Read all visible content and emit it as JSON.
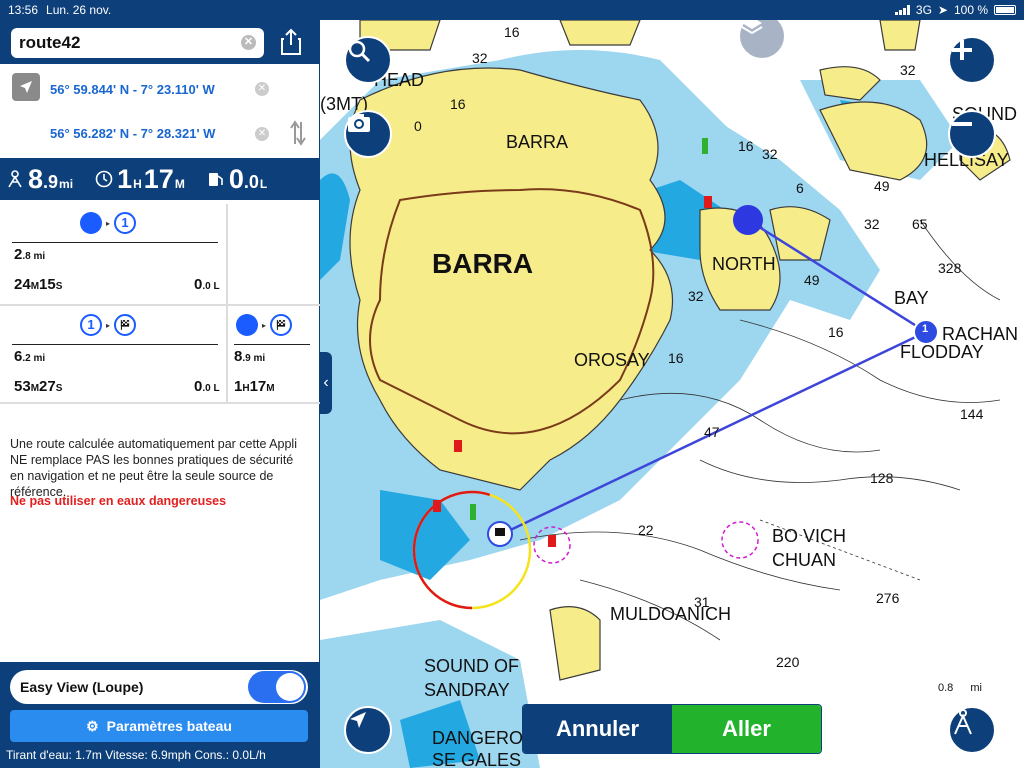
{
  "status": {
    "time": "13:56",
    "date": "Lun. 26 nov.",
    "network": "3G",
    "battery": "100 %"
  },
  "route": {
    "name": "route42"
  },
  "coords": {
    "start": "56° 59.844' N - 7° 23.110' W",
    "end": "56° 56.282' N - 7° 28.321' W"
  },
  "summary": {
    "distance_big": "8",
    "distance_small": ".9",
    "distance_unit": "mi",
    "time_h": "1",
    "time_h_unit": "H",
    "time_m": "17",
    "time_m_unit": "M",
    "fuel_big": "0",
    "fuel_small": ".0",
    "fuel_unit": "L"
  },
  "legs": [
    {
      "from": "dot",
      "to": "1",
      "dist_big": "2",
      "dist_small": ".8 mi",
      "time_m": "24",
      "time_m_unit": "M",
      "time_s": "15",
      "time_s_unit": "S",
      "fuel_big": "0",
      "fuel_small": ".0 L"
    },
    {
      "from": "1",
      "to": "flag",
      "dist_big": "6",
      "dist_small": ".2 mi",
      "time_m": "53",
      "time_m_unit": "M",
      "time_s": "27",
      "time_s_unit": "S",
      "fuel_big": "0",
      "fuel_small": ".0 L"
    },
    {
      "from": "dot",
      "to": "flag",
      "dist_big": "8",
      "dist_small": ".9 mi",
      "time_h": "1",
      "time_h_unit": "H",
      "time_m": "17",
      "time_m_unit": "M"
    }
  ],
  "disclaimer": "Une route calculée automatiquement par cette Appli NE remplace PAS les bonnes pratiques de sécurité en navigation et ne peut être la seule source de référence.",
  "warning": "Ne pas utiliser en eaux dangereuses",
  "easy_view": {
    "label": "Easy View (Loupe)",
    "enabled": true
  },
  "params_button": "Paramètres bateau",
  "footer": "Tirant d'eau: 1.7m Vitesse: 6.9mph Cons.: 0.0L/h",
  "map": {
    "labels": [
      "BARRA",
      "BARRA",
      "NORTH",
      "BAY",
      "OROSAY",
      "HELLISAY",
      "RACHAN",
      "FLODDAY",
      "BO VICH",
      "CHUAN",
      "MULDOANICH",
      "SOUND OF",
      "SANDRAY",
      "DANGERO",
      "SE GALES",
      "HEAD",
      "(3MT)",
      "SOUND"
    ],
    "depths": [
      "16",
      "32",
      "16",
      "32",
      "16",
      "32",
      "49",
      "65",
      "328",
      "32",
      "16",
      "49",
      "144",
      "128",
      "47",
      "22",
      "276",
      "220",
      "31",
      "0",
      "6",
      "16",
      "32"
    ],
    "waypoint": "1",
    "scale_text": "0.8",
    "scale_unit": "mi"
  },
  "buttons": {
    "cancel": "Annuler",
    "go": "Aller"
  },
  "colors": {
    "navy": "#0d3f7a",
    "route_line": "#3d46d8",
    "go_green": "#22b22b",
    "land": "#f7ec8a",
    "shallow": "#7cc8e8",
    "deep_shallow": "#1aa3e0"
  }
}
